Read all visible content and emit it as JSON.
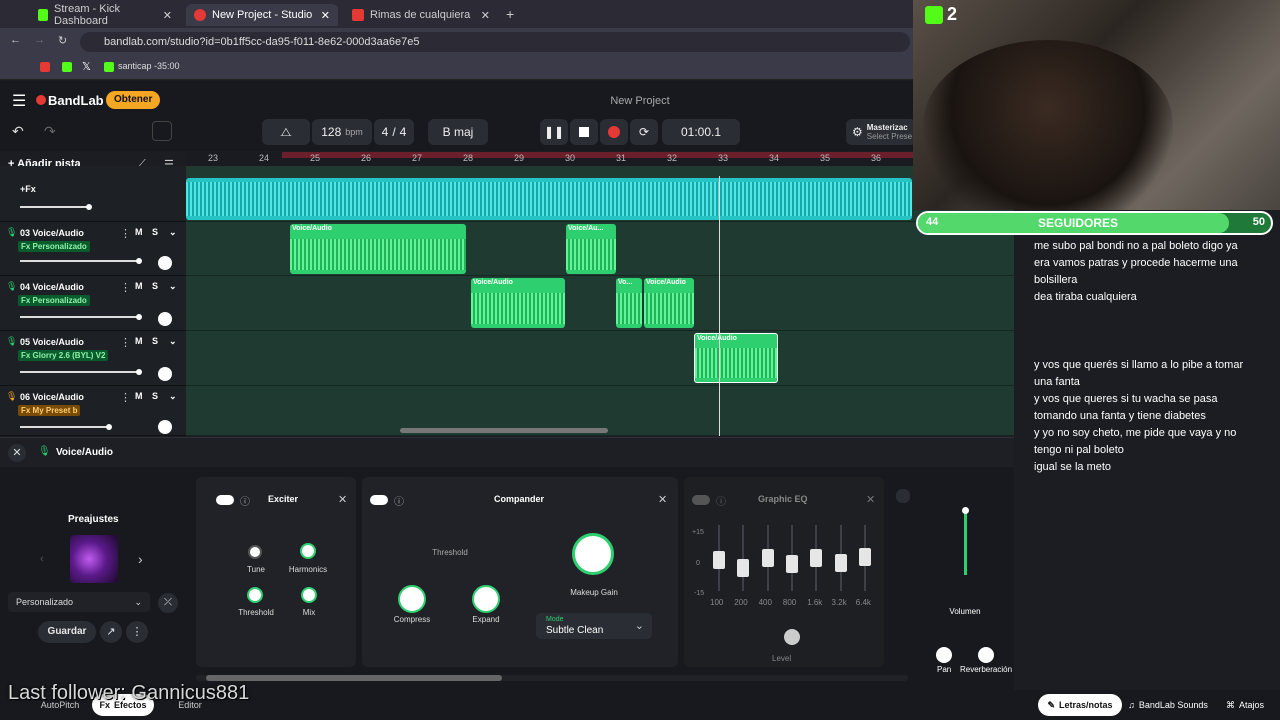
{
  "browser": {
    "tabs": [
      {
        "label": "Stream - Kick Dashboard",
        "color": "#53fc18"
      },
      {
        "label": "New Project - Studio",
        "color": "#e53935"
      },
      {
        "label": "Rimas de cualquiera",
        "color": "#e53935"
      }
    ],
    "url": "bandlab.com/studio?id=0b1ff5cc-da95-f011-8e62-000d3aa6e7e5",
    "bookmark_label": "santicap -35:00"
  },
  "app": {
    "logo": "BandLab",
    "upgrade_button": "Obtener",
    "project_title": "New Project",
    "tempo": "128",
    "tempo_unit": "bpm",
    "time_sig_top": "4",
    "time_sig_sep": "/",
    "time_sig_bottom": "4",
    "key": "B maj",
    "time": "01:00.1",
    "mastering_label": "Masterizac",
    "mastering_sub": "Select Prese",
    "add_track": "+ Añadir pista",
    "accent": "#2ecf6e",
    "brand": "#e53935"
  },
  "ruler": [
    "23",
    "24",
    "25",
    "26",
    "27",
    "28",
    "29",
    "30",
    "31",
    "32",
    "33",
    "34",
    "35",
    "36"
  ],
  "tracks": [
    {
      "fx": "+Fx"
    },
    {
      "name": "03  Voice/Audio",
      "fx": "Fx Personalizado",
      "mute": "M",
      "solo": "S"
    },
    {
      "name": "04  Voice/Audio",
      "fx": "Fx Personalizado",
      "mute": "M",
      "solo": "S"
    },
    {
      "name": "05  Voice/Audio",
      "fx": "Fx Glorry 2.6 (BYL) V2",
      "mute": "M",
      "solo": "S"
    },
    {
      "name": "06  Voice/Audio",
      "fx": "Fx My Preset b",
      "mute": "M",
      "solo": "S"
    }
  ],
  "clips": {
    "c1": "Voice/Audio",
    "c2": "Voice/Au...",
    "c3": "Voice/Audio",
    "c4": "Vo...",
    "c5": "Voice/Audio",
    "c6": "Voice/Audio"
  },
  "panel": {
    "track_label": "Voice/Audio",
    "presets_title": "Preajustes",
    "preset_select": "Personalizado",
    "save_button": "Guardar",
    "exciter": {
      "title": "Exciter",
      "tune": "Tune",
      "harmonics": "Harmonics",
      "threshold": "Threshold",
      "mix": "Mix"
    },
    "compander": {
      "title": "Compander",
      "threshold": "Threshold",
      "compress": "Compress",
      "expand": "Expand",
      "makeup": "Makeup Gain",
      "mode_label": "Mode",
      "mode_value": "Subtle Clean"
    },
    "eq": {
      "title": "Graphic EQ",
      "scale": [
        "+15",
        "0",
        "-15"
      ],
      "bands": [
        "100",
        "200",
        "400",
        "800",
        "1.6k",
        "3.2k",
        "6.4k"
      ],
      "level": "Level"
    },
    "volume": "Volumen",
    "pan": "Pan",
    "reverb": "Reverberación"
  },
  "stream": {
    "kick_viewers": "2",
    "follow_current": "44",
    "follow_label": "SEGUIDORES",
    "follow_goal": "50",
    "follow_progress": 0.88,
    "last_follower": "Last follower: Gannicus881"
  },
  "lyrics": [
    "me subo pal bondi no a pal boleto digo ya",
    "era vamos patras y procede hacerme una",
    "bolsillera",
    "dea tiraba cualquiera",
    "y vos que querés si llamo a lo pibe a tomar",
    "una fanta",
    "y vos que queres si tu wacha se pasa",
    "tomando una fanta y tiene diabetes",
    "y yo no soy cheto, me pide que vaya y no",
    "tengo ni pal boleto",
    "igual se la meto"
  ],
  "bottom": {
    "autopitch": "AutoPitch",
    "effects": "Efectos",
    "editor": "Editor",
    "lyrics_notes": "Letras/notas",
    "sounds": "BandLab Sounds",
    "shortcuts": "Atajos"
  }
}
